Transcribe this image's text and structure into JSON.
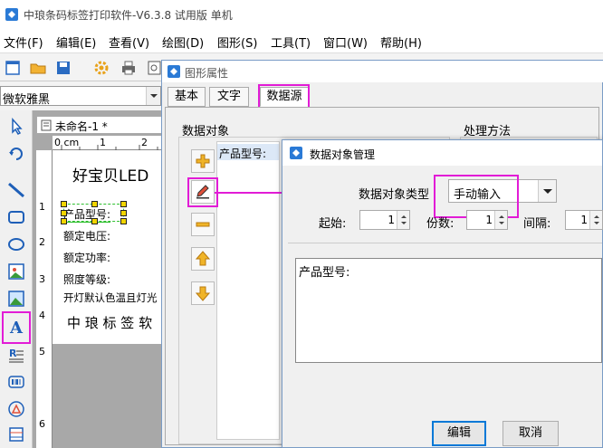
{
  "app": {
    "title": "中琅条码标签打印软件-V6.3.8 试用版 单机"
  },
  "menu": [
    "文件(F)",
    "编辑(E)",
    "查看(V)",
    "绘图(D)",
    "图形(S)",
    "工具(T)",
    "窗口(W)",
    "帮助(H)"
  ],
  "font_select": {
    "value": "微软雅黑"
  },
  "document": {
    "tab_label": "未命名-1 *",
    "ruler_h": [
      "0 cm",
      "1",
      "2"
    ],
    "ruler_v": [
      "1",
      "2",
      "3",
      "4",
      "5",
      "6"
    ]
  },
  "label": {
    "title": "好宝贝LED",
    "lines": [
      "产品型号:",
      "额定电压:",
      "额定功率:",
      "照度等级:",
      "开灯默认色温且灯光"
    ],
    "brand": "中 琅 标 签 软"
  },
  "prop_dialog": {
    "title": "图形属性",
    "tabs": [
      "基本",
      "文字",
      "数据源"
    ],
    "data_objects_label": "数据对象",
    "process_label": "处理方法",
    "object_item": "产品型号:"
  },
  "mgr_dialog": {
    "title": "数据对象管理",
    "type_label": "数据对象类型",
    "type_value": "手动输入",
    "start_label": "起始:",
    "start_value": "1",
    "copies_label": "份数:",
    "copies_value": "1",
    "interval_label": "间隔:",
    "interval_value": "1",
    "content": "产品型号:",
    "edit_button": "编辑",
    "cancel_button": "取消"
  },
  "colors": {
    "highlight": "#e21cd6",
    "accent": "#1e6fd0"
  }
}
